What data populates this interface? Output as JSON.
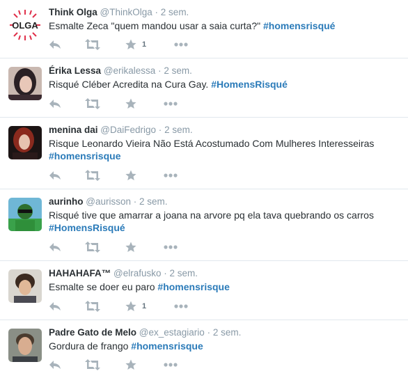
{
  "colors": {
    "link": "#2b7bb9",
    "icon": "#a8b3bb",
    "muted": "#8899a6",
    "border": "#e1e8ed"
  },
  "icons": {
    "reply": "reply-icon",
    "retweet": "retweet-icon",
    "favorite": "star-icon",
    "more": "more-dots-icon"
  },
  "tweets": [
    {
      "name": "Think Olga",
      "handle": "@ThinkOlga",
      "sep": "·",
      "time": "2 sem.",
      "text": "Esmalte Zeca \"quem mandou usar a saia curta?\"",
      "line2": "",
      "hashtag": "#homensrisqué",
      "fav_count": "1",
      "avatar_text": "OLGA"
    },
    {
      "name": "Érika Lessa",
      "handle": "@erikalessa",
      "sep": "·",
      "time": "2 sem.",
      "text": "Risqué Cléber Acredita na Cura Gay.",
      "line2": "",
      "hashtag": "#HomensRisqué",
      "fav_count": ""
    },
    {
      "name": "menina dai",
      "handle": "@DaiFedrigo",
      "sep": "·",
      "time": "2 sem.",
      "text": "Risque Leonardo Vieira Não Está Acostumado Com Mulheres Interesseiras",
      "line2": "",
      "hashtag": "#homensrisque",
      "fav_count": ""
    },
    {
      "name": "aurinho",
      "handle": "@aurisson",
      "sep": "·",
      "time": "2 sem.",
      "text": "Risqué tive que amarrar a joana na arvore pq ela tava quebrando os carros",
      "line2": "",
      "hashtag": "#HomensRisqué",
      "fav_count": ""
    },
    {
      "name": "HAHAHAFA™",
      "handle": "@elrafusko",
      "sep": "·",
      "time": "2 sem.",
      "text": "Esmalte se doer eu paro",
      "line2": "",
      "hashtag": "#homensrisque",
      "fav_count": "1"
    },
    {
      "name": "Padre Gato de Melo",
      "handle": "@ex_estagiario",
      "sep": "·",
      "time": "2 sem.",
      "text": "Gordura de frango",
      "line2": "",
      "hashtag": "#homensrisque",
      "fav_count": ""
    }
  ]
}
